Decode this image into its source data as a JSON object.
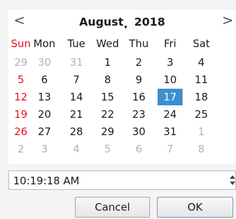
{
  "header": {
    "prev_icon": "chevron-left-icon",
    "prev_glyph": "<",
    "next_icon": "chevron-right-icon",
    "next_glyph": ">",
    "month": "August",
    "year": "2018"
  },
  "weekdays": [
    "Sun",
    "Mon",
    "Tue",
    "Wed",
    "Thu",
    "Fri",
    "Sat"
  ],
  "weeks": [
    [
      "29",
      "30",
      "31",
      "1",
      "2",
      "3",
      "4"
    ],
    [
      "5",
      "6",
      "7",
      "8",
      "9",
      "10",
      "11"
    ],
    [
      "12",
      "13",
      "14",
      "15",
      "16",
      "17",
      "18"
    ],
    [
      "19",
      "20",
      "21",
      "22",
      "23",
      "24",
      "25"
    ],
    [
      "26",
      "27",
      "28",
      "29",
      "30",
      "31",
      "1"
    ],
    [
      "2",
      "3",
      "4",
      "5",
      "6",
      "7",
      "8"
    ]
  ],
  "current_month_flags": [
    [
      false,
      false,
      false,
      true,
      true,
      true,
      true
    ],
    [
      true,
      true,
      true,
      true,
      true,
      true,
      true
    ],
    [
      true,
      true,
      true,
      true,
      true,
      true,
      true
    ],
    [
      true,
      true,
      true,
      true,
      true,
      true,
      true
    ],
    [
      true,
      true,
      true,
      true,
      true,
      true,
      false
    ],
    [
      false,
      false,
      false,
      false,
      false,
      false,
      false
    ]
  ],
  "selected_day": "17",
  "colors": {
    "sunday": "#e4121b",
    "selected_bg": "#3b8fd0",
    "other_month": "#b3b3b3"
  },
  "time": {
    "value": "10:19:18 AM"
  },
  "buttons": {
    "cancel": "Cancel",
    "ok": "OK"
  }
}
